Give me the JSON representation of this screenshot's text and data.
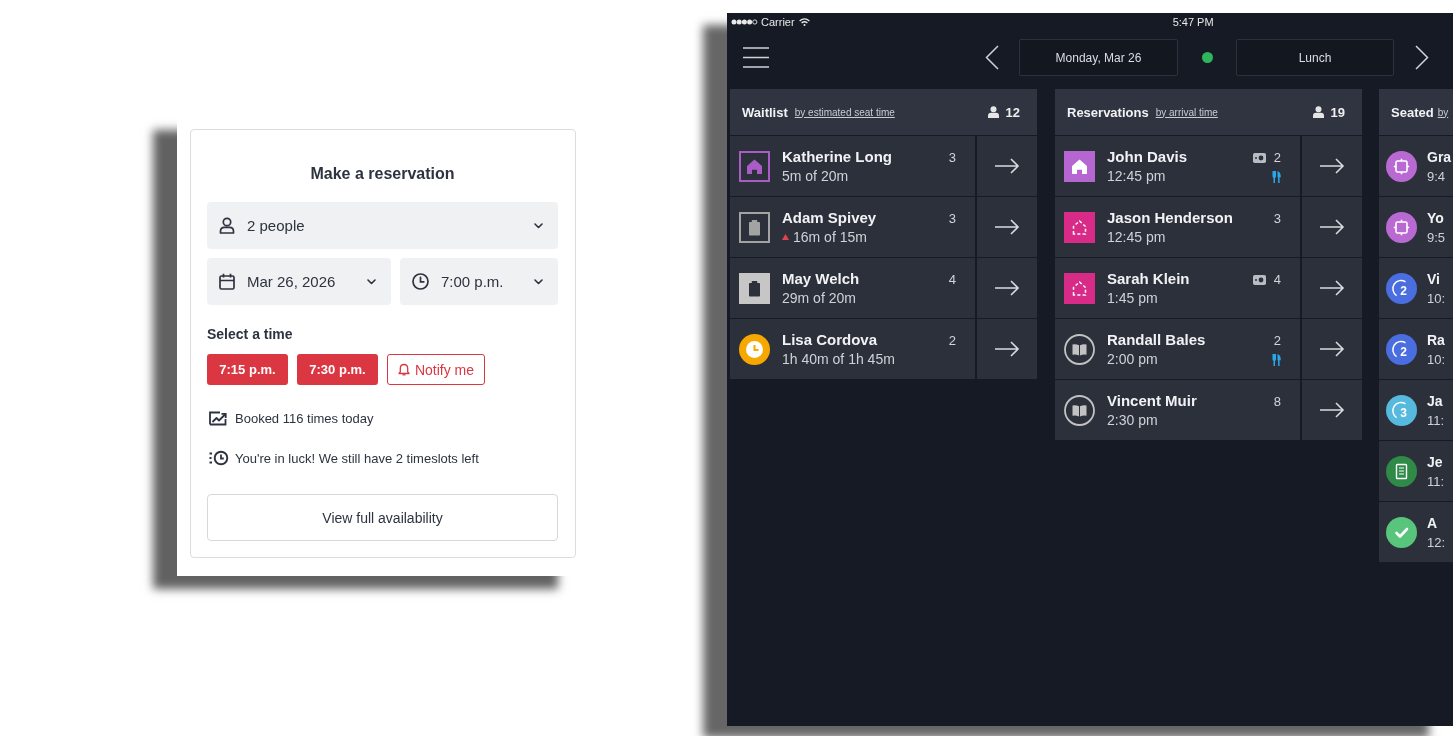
{
  "reservation_card": {
    "title": "Make a reservation",
    "party_size": "2 people",
    "date": "Mar 26, 2026",
    "time": "7:00 p.m.",
    "slots_label": "Select a time",
    "slots": [
      {
        "kind": "time",
        "label": "7:15 p.m."
      },
      {
        "kind": "time",
        "label": "7:30 p.m."
      },
      {
        "kind": "notify",
        "label": "Notify me"
      }
    ],
    "notes": [
      {
        "kind": "trend",
        "text": "Booked 116 times today"
      },
      {
        "kind": "timeslots",
        "text": "You're in luck! We still have 2 timeslots left"
      }
    ],
    "availability_button": "View full availability"
  },
  "host_app": {
    "status_bar": {
      "carrier": "Carrier",
      "time": "5:47 PM"
    },
    "nav_bar": {
      "date": "Monday, Mar 26",
      "service": "Lunch"
    },
    "columns": [
      {
        "title": "Waitlist",
        "sort_link": "by estimated seat time",
        "count": "12",
        "rows": [
          {
            "name": "Katherine Long",
            "detail": "5m of 20m",
            "party": "3",
            "kind": "house",
            "color": "#a95cc6",
            "filled": false,
            "overdue": false
          },
          {
            "name": "Adam Spivey",
            "detail": "16m of 15m",
            "party": "3",
            "kind": "clipboard",
            "color": "#a3a3a3",
            "filled": false,
            "overdue": true
          },
          {
            "name": "May Welch",
            "detail": "29m of 20m",
            "party": "4",
            "kind": "clipboard",
            "color": "#c6c6c6",
            "filled": true,
            "overdue": false
          },
          {
            "name": "Lisa Cordova",
            "detail": "1h 40m of 1h 45m",
            "party": "2",
            "kind": "clock",
            "color": "#f6a800",
            "filled": true,
            "overdue": false
          }
        ]
      },
      {
        "title": "Reservations",
        "sort_link": "by arrival time",
        "count": "19",
        "rows": [
          {
            "name": "John Davis",
            "detail": "12:45 pm",
            "party": "2",
            "kind": "house",
            "color": "#b566d0",
            "filled": true,
            "wallet_icon": true,
            "utensils_icon": true
          },
          {
            "name": "Jason Henderson",
            "detail": "12:45 pm",
            "party": "3",
            "kind": "dashed-house",
            "color": "#d82b87",
            "filled": true,
            "wallet_icon": false,
            "utensils_icon": false
          },
          {
            "name": "Sarah Klein",
            "detail": "1:45 pm",
            "party": "4",
            "kind": "dashed-house",
            "color": "#d82b87",
            "filled": true,
            "wallet_icon": true,
            "utensils_icon": false
          },
          {
            "name": "Randall Bales",
            "detail": "2:00 pm",
            "party": "2",
            "kind": "book",
            "color": "#c2c2c2",
            "filled": false,
            "wallet_icon": false,
            "utensils_icon": true
          },
          {
            "name": "Vincent Muir",
            "detail": "2:30 pm",
            "party": "8",
            "kind": "book",
            "color": "#c2c2c2",
            "filled": false,
            "wallet_icon": false,
            "utensils_icon": false
          }
        ]
      },
      {
        "title": "Seated",
        "sort_link": "by",
        "rows": [
          {
            "name": "Gra",
            "detail": "9:4",
            "kind": "table",
            "color": "#b86ad2",
            "filled": true
          },
          {
            "name": "Yo",
            "detail": "9:5",
            "kind": "table",
            "color": "#b86ad2",
            "filled": true
          },
          {
            "name": "Vi",
            "detail": "10:",
            "kind": "progress",
            "badge_text": "2",
            "color": "#4a6ee0",
            "filled": true
          },
          {
            "name": "Ra",
            "detail": "10:",
            "kind": "progress",
            "badge_text": "2",
            "color": "#4a6ee0",
            "filled": true
          },
          {
            "name": "Ja",
            "detail": "11:",
            "kind": "progress",
            "badge_text": "3",
            "color": "#56b9de",
            "filled": true
          },
          {
            "name": "Je",
            "detail": "11:",
            "kind": "receipt",
            "color": "#2f8a48",
            "filled": true
          },
          {
            "name": "A",
            "detail": "12:",
            "kind": "check",
            "color": "#58c47c",
            "filled": true
          }
        ]
      }
    ]
  }
}
